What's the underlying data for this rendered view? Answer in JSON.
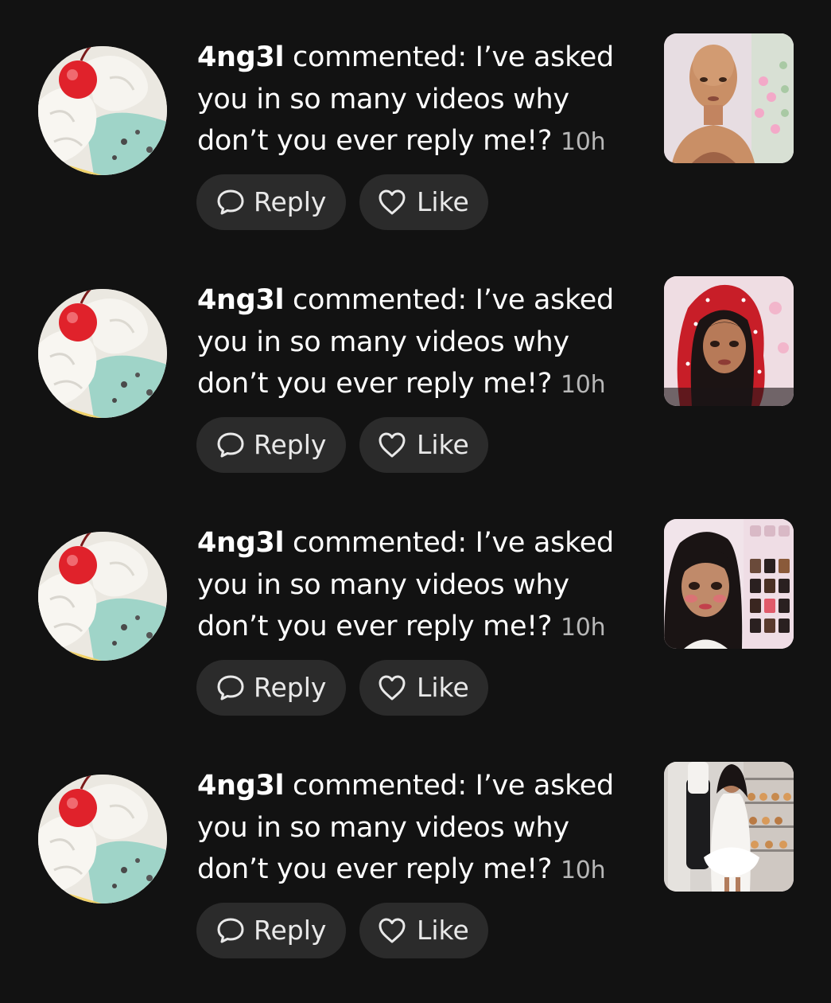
{
  "notifications": [
    {
      "username": "4ng3l",
      "action": " commented: ",
      "comment": "I’ve asked you in so many videos why don’t you ever reply me!?",
      "time": "10h",
      "reply_label": "Reply",
      "like_label": "Like",
      "thumbnail": "bald-avatar-video"
    },
    {
      "username": "4ng3l",
      "action": " commented: ",
      "comment": "I’ve asked you in so many videos why don’t you ever reply me!?",
      "time": "10h",
      "reply_label": "Reply",
      "like_label": "Like",
      "thumbnail": "red-headscarf-video"
    },
    {
      "username": "4ng3l",
      "action": " commented: ",
      "comment": "I’ve asked you in so many videos why don’t you ever reply me!?",
      "time": "10h",
      "reply_label": "Reply",
      "like_label": "Like",
      "thumbnail": "character-creator-video"
    },
    {
      "username": "4ng3l",
      "action": " commented: ",
      "comment": "I’ve asked you in so many videos why don’t you ever reply me!?",
      "time": "10h",
      "reply_label": "Reply",
      "like_label": "Like",
      "thumbnail": "bakery-outfit-video"
    }
  ],
  "icons": {
    "reply": "speech-bubble-icon",
    "like": "heart-icon"
  },
  "colors": {
    "background": "#121212",
    "pill": "#2b2b2b",
    "text": "#ffffff",
    "timestamp": "#b7b7b7"
  }
}
